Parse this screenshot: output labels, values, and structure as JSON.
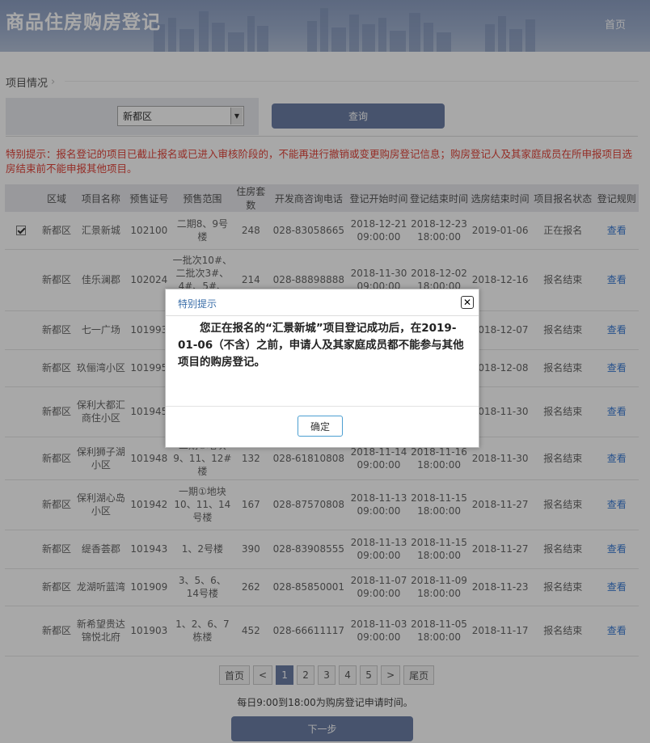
{
  "header": {
    "title": "商品住房购房登记",
    "home": "首页"
  },
  "section": {
    "title": "项目情况"
  },
  "filter": {
    "district": "新都区",
    "query_label": "查询"
  },
  "notice": "特别提示：报名登记的项目已截止报名或已进入审核阶段的，不能再进行撤销或变更购房登记信息；购房登记人及其家庭成员在所申报项目选房结束前不能申报其他项目。",
  "table": {
    "columns": [
      "",
      "区域",
      "项目名称",
      "预售证号",
      "预售范围",
      "住房套数",
      "开发商咨询电话",
      "登记开始时间",
      "登记结束时间",
      "选房结束时间",
      "项目报名状态",
      "登记规则"
    ],
    "rows": [
      {
        "checked": true,
        "area": "新都区",
        "name": "汇景新城",
        "cert": "102100",
        "range": "二期8、9号楼",
        "units": "248",
        "phone": "028-83058665",
        "start": "2018-12-21 09:00:00",
        "end": "2018-12-23 18:00:00",
        "pick_end": "2019-01-06",
        "status": "正在报名",
        "rule": "查看"
      },
      {
        "checked": false,
        "area": "新都区",
        "name": "佳乐澜郡",
        "cert": "102024",
        "range": "一批次10#、二批次3#、4#、5#、6#、7#楼",
        "units": "214",
        "phone": "028-88898888",
        "start": "2018-11-30 09:00:00",
        "end": "2018-12-02 18:00:00",
        "pick_end": "2018-12-16",
        "status": "报名结束",
        "rule": "查看"
      },
      {
        "checked": false,
        "area": "新都区",
        "name": "七一广场",
        "cert": "101993",
        "range": "",
        "units": "",
        "phone": "",
        "start": "",
        "end": "",
        "pick_end": "2018-12-07",
        "status": "报名结束",
        "rule": "查看"
      },
      {
        "checked": false,
        "area": "新都区",
        "name": "玖俪湾小区",
        "cert": "101995",
        "range": "",
        "units": "",
        "phone": "",
        "start": "",
        "end": "",
        "pick_end": "2018-12-08",
        "status": "报名结束",
        "rule": "查看"
      },
      {
        "checked": false,
        "area": "新都区",
        "name": "保利大都汇商住小区",
        "cert": "101945",
        "range": "",
        "units": "",
        "phone": "",
        "start": "",
        "end": "",
        "pick_end": "2018-11-30",
        "status": "报名结束",
        "rule": "查看"
      },
      {
        "checked": false,
        "area": "新都区",
        "name": "保利狮子湖小区",
        "cert": "101948",
        "range": "二期①地块9、11、12#楼",
        "units": "132",
        "phone": "028-61810808",
        "start": "2018-11-14 09:00:00",
        "end": "2018-11-16 18:00:00",
        "pick_end": "2018-11-30",
        "status": "报名结束",
        "rule": "查看"
      },
      {
        "checked": false,
        "area": "新都区",
        "name": "保利湖心岛小区",
        "cert": "101942",
        "range": "一期①地块10、11、14号楼",
        "units": "167",
        "phone": "028-87570808",
        "start": "2018-11-13 09:00:00",
        "end": "2018-11-15 18:00:00",
        "pick_end": "2018-11-27",
        "status": "报名结束",
        "rule": "查看"
      },
      {
        "checked": false,
        "area": "新都区",
        "name": "缇香荟郡",
        "cert": "101943",
        "range": "1、2号楼",
        "units": "390",
        "phone": "028-83908555",
        "start": "2018-11-13 09:00:00",
        "end": "2018-11-15 18:00:00",
        "pick_end": "2018-11-27",
        "status": "报名结束",
        "rule": "查看"
      },
      {
        "checked": false,
        "area": "新都区",
        "name": "龙湖听蓝湾",
        "cert": "101909",
        "range": "3、5、6、14号楼",
        "units": "262",
        "phone": "028-85850001",
        "start": "2018-11-07 09:00:00",
        "end": "2018-11-09 18:00:00",
        "pick_end": "2018-11-23",
        "status": "报名结束",
        "rule": "查看"
      },
      {
        "checked": false,
        "area": "新都区",
        "name": "新希望贵达锦悦北府",
        "cert": "101903",
        "range": "1、2、6、7栋楼",
        "units": "452",
        "phone": "028-66611117",
        "start": "2018-11-03 09:00:00",
        "end": "2018-11-05 18:00:00",
        "pick_end": "2018-11-17",
        "status": "报名结束",
        "rule": "查看"
      }
    ]
  },
  "pager": {
    "first": "首页",
    "prev": "<",
    "pages": [
      "1",
      "2",
      "3",
      "4",
      "5"
    ],
    "active": "1",
    "next": ">",
    "last": "尾页"
  },
  "footer": {
    "apply_time": "每日9:00到18:00为购房登记申请时间。",
    "next_label": "下一步"
  },
  "dialog": {
    "title": "特别提示",
    "message": "您正在报名的“汇景新城”项目登记成功后，在2019-01-06（不含）之前，申请人及其家庭成员都不能参与其他项目的购房登记。",
    "ok_label": "确定",
    "close_icon": "close-icon"
  },
  "colors": {
    "brand": "#6c7fa6",
    "notice": "#e2453b",
    "link": "#3a7bd5",
    "dialog_title": "#3a6ea8"
  }
}
